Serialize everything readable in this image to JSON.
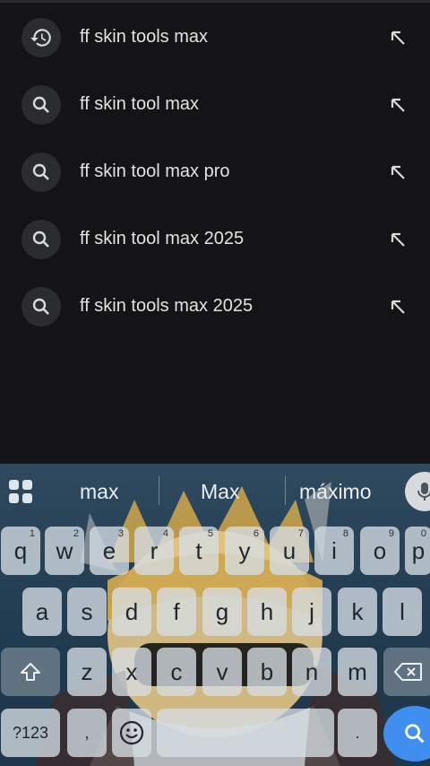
{
  "suggestions": [
    {
      "text": "ff skin tools max",
      "icon": "history-icon"
    },
    {
      "text": "ff skin tool max",
      "icon": "search-icon"
    },
    {
      "text": "ff skin tool max pro",
      "icon": "search-icon"
    },
    {
      "text": "ff skin tool max 2025",
      "icon": "search-icon"
    },
    {
      "text": "ff skin tools max 2025",
      "icon": "search-icon"
    }
  ],
  "keyboard": {
    "word_suggestions": [
      "max",
      "Max",
      "máximo"
    ],
    "row1": [
      {
        "key": "q",
        "hint": "1"
      },
      {
        "key": "w",
        "hint": "2"
      },
      {
        "key": "e",
        "hint": "3"
      },
      {
        "key": "r",
        "hint": "4"
      },
      {
        "key": "t",
        "hint": "5"
      },
      {
        "key": "y",
        "hint": "6"
      },
      {
        "key": "u",
        "hint": "7"
      },
      {
        "key": "i",
        "hint": "8"
      },
      {
        "key": "o",
        "hint": "9"
      },
      {
        "key": "p",
        "hint": "0"
      }
    ],
    "row2": [
      "a",
      "s",
      "d",
      "f",
      "g",
      "h",
      "j",
      "k",
      "l"
    ],
    "row3": [
      "z",
      "x",
      "c",
      "v",
      "b",
      "n",
      "m"
    ],
    "symbols_label": "?123",
    "comma": ",",
    "period": "."
  },
  "colors": {
    "background": "#141416",
    "accent": "#3f8ef0"
  }
}
